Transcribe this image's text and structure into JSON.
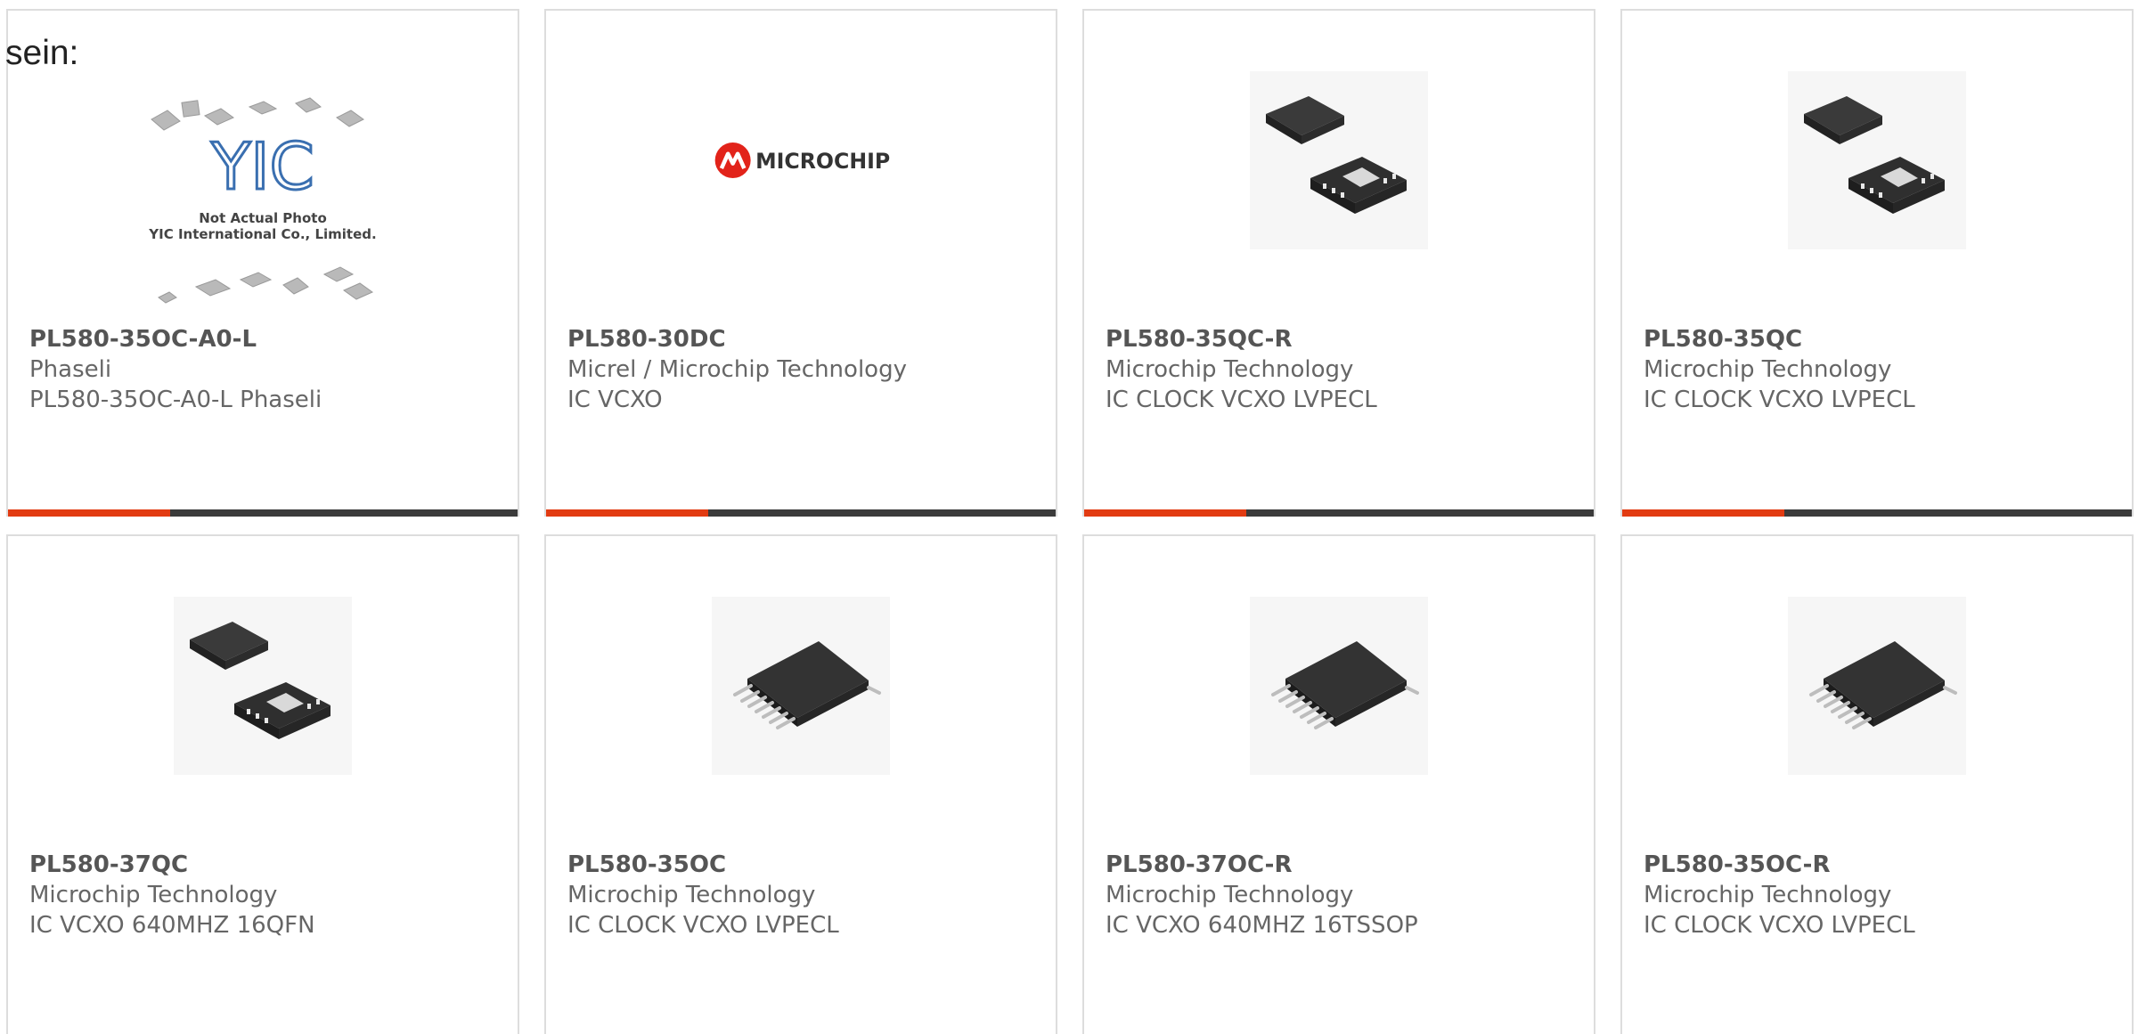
{
  "intro_text": "sein:",
  "products": [
    {
      "part": "PL580-35OC-A0-L",
      "maker": "Phaseli",
      "desc": "PL580-35OC-A0-L Phaseli",
      "image": "placeholder-logo"
    },
    {
      "part": "PL580-30DC",
      "maker": "Micrel / Microchip Technology",
      "desc": "IC VCXO",
      "image": "microchip-logo"
    },
    {
      "part": "PL580-35QC-R",
      "maker": "Microchip Technology",
      "desc": "IC CLOCK VCXO LVPECL",
      "image": "qfn-chip"
    },
    {
      "part": "PL580-35QC",
      "maker": "Microchip Technology",
      "desc": "IC CLOCK VCXO LVPECL",
      "image": "qfn-chip"
    },
    {
      "part": "PL580-37QC",
      "maker": "Microchip Technology",
      "desc": "IC VCXO 640MHZ 16QFN",
      "image": "qfn-chip"
    },
    {
      "part": "PL580-35OC",
      "maker": "Microchip Technology",
      "desc": "IC CLOCK VCXO LVPECL",
      "image": "tssop-chip"
    },
    {
      "part": "PL580-37OC-R",
      "maker": "Microchip Technology",
      "desc": "IC VCXO 640MHZ 16TSSOP",
      "image": "tssop-chip"
    },
    {
      "part": "PL580-35OC-R",
      "maker": "Microchip Technology",
      "desc": "IC CLOCK VCXO LVPECL",
      "image": "tssop-chip"
    }
  ],
  "placeholder": {
    "brand": "YIC",
    "line1": "Not Actual Photo",
    "line2": "YIC International Co., Limited."
  },
  "microchip_brand": "MICROCHIP",
  "colors": {
    "accent": "#e23b12",
    "bar": "#3b3b3b",
    "border": "#dddddd",
    "text": "#666666"
  }
}
